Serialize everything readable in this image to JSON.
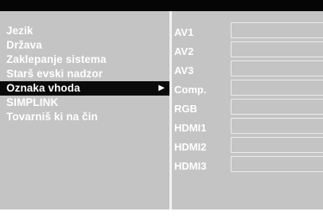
{
  "menu": {
    "items": [
      {
        "label": "Jezik"
      },
      {
        "label": "Država"
      },
      {
        "label": "Zaklepanje sistema"
      },
      {
        "label": "Starš evski nadzor"
      },
      {
        "label": "Oznaka vhoda",
        "selected": true,
        "arrow": "▶"
      },
      {
        "label": "SIMPLINK"
      },
      {
        "label": "Tovarniš ki na čin"
      }
    ]
  },
  "inputs": {
    "items": [
      {
        "label": "AV1",
        "value": ""
      },
      {
        "label": "AV2",
        "value": ""
      },
      {
        "label": "AV3",
        "value": ""
      },
      {
        "label": "Comp.",
        "value": ""
      },
      {
        "label": "RGB",
        "value": ""
      },
      {
        "label": "HDMI1",
        "value": ""
      },
      {
        "label": "HDMI2",
        "value": ""
      },
      {
        "label": "HDMI3",
        "value": ""
      }
    ]
  },
  "colors": {
    "panel": "#c4c4c4",
    "frame": "#050505",
    "highlight": "#0a0a0a",
    "text": "#ffffff"
  }
}
